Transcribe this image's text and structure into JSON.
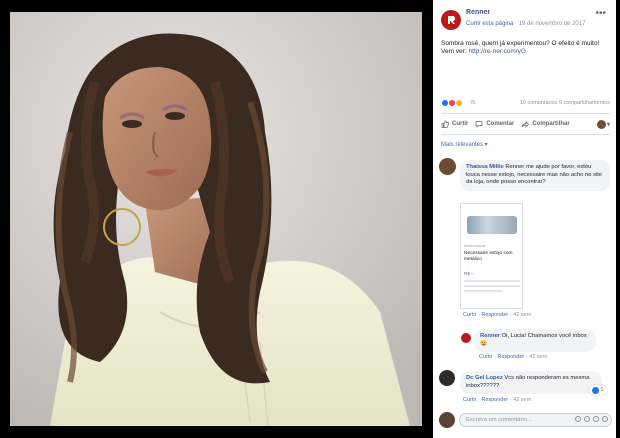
{
  "post": {
    "page_name": "Renner",
    "like_page": "Curtir esta página",
    "date": "19 de novembro de 2017",
    "text": "Sombra rosê, quem já experimentou? O efeito é muito! Vem ver:",
    "link": "http://re-ner.com/yG",
    "reaction_count": "7k",
    "stats": "10 comentários  6 compartilhamentos"
  },
  "actions": {
    "like": "Curtir",
    "comment": "Comentar",
    "share": "Compartilhar"
  },
  "sort_label": "Mais relevantes ▾",
  "comments": [
    {
      "author": "Thaissa Millie",
      "text": "Renner me ajude por favor, estou louca nesse estojo, necessaire mas não acho no site da loja, onde posso encontrar?",
      "like": "Curtir",
      "reply": "Responder",
      "time": "42 sem"
    },
    {
      "author": "Renner",
      "text": "Oi, Lucia! Chamamos você inbox 😉",
      "like": "Curtir",
      "reply": "Responder",
      "time": "42 sem"
    },
    {
      "author": "Dc Gel Lopez",
      "text": "Vcs não responderam es mesma inbox??????",
      "like": "Curtir",
      "reply": "Responder",
      "time": "42 sem",
      "like_count": "1"
    }
  ],
  "attachment": {
    "source": "renner.com.br",
    "title": "Necessaire estojo com metálico",
    "price": "R$ --"
  },
  "composer": {
    "placeholder": "Escreva um comentário..."
  },
  "colors": {
    "brand": "#b71c1c",
    "link": "#385898",
    "accent": "#4267b2"
  }
}
